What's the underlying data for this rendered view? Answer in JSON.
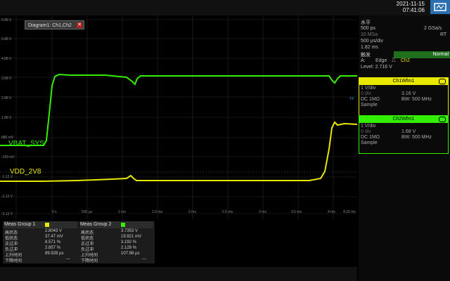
{
  "topbar": {
    "date": "2021-11-15",
    "time": "07:41:06"
  },
  "diagram": {
    "tab_title": "Diagram1: Ch1,Ch2",
    "close_glyph": "✕",
    "y_labels": [
      "6.88 V",
      "5.88 V",
      "4.88 V",
      "3.88 V",
      "2.88 V",
      "1.88 V",
      "880 mV",
      "-120 mV",
      "-1.12 V",
      "-2.12 V",
      "-3.12 V"
    ],
    "x_labels": [
      "0 s",
      "500 µs",
      "1 ms",
      "1.5 ms",
      "2 ms",
      "2.5 ms",
      "3 ms",
      "3.5 ms",
      "4 ms",
      "4.32 ms"
    ],
    "ch1_label": "VBAT_SYS",
    "ch2_label": "VDD_2V8",
    "ch1_color": "#33ee00",
    "ch2_color": "#e8e800",
    "ref_marker": "T4"
  },
  "horizontal": {
    "title": "水平",
    "timebase": "500 ps",
    "rate": "2 GSa/s",
    "rt": "RT",
    "mem": "10 MSa",
    "div": "500 µs/div",
    "acq": "1.82 ms"
  },
  "trigger": {
    "title": "触发",
    "mode": "Normal",
    "source_prefix": "A:",
    "type": "Edge",
    "source": "Ch2",
    "level": "Level: 2.716 V"
  },
  "ch1": {
    "title": "Ch1Wfm1",
    "scale": "1 V/div",
    "offset_label": "0 div",
    "offset_value": "3.16 V",
    "coupling": "DC 1MΩ",
    "bw": "BW: 500 MHz",
    "mode": "Sample"
  },
  "ch2": {
    "title": "Ch2Wfm1",
    "scale": "1 V/div",
    "offset_label": "0 div",
    "offset_value": "1.68 V",
    "coupling": "DC 1MΩ",
    "bw": "BW: 500 MHz",
    "mode": "Sample"
  },
  "meas1": {
    "title": "Meas Group 1",
    "rows": [
      {
        "label": "高状态",
        "value": "2.8043 V"
      },
      {
        "label": "低状态",
        "value": "37.47 mV"
      },
      {
        "label": "正过冲",
        "value": "8.571 %"
      },
      {
        "label": "负过冲",
        "value": "2.857 %"
      },
      {
        "label": "上升时间",
        "value": "89.928 µs"
      },
      {
        "label": "下降时间",
        "value": "---"
      }
    ]
  },
  "meas2": {
    "title": "Meas Group 2",
    "rows": [
      {
        "label": "高状态",
        "value": "3.7353 V"
      },
      {
        "label": "低状态",
        "value": "19.921 mV"
      },
      {
        "label": "正过冲",
        "value": "3.192 %"
      },
      {
        "label": "负过冲",
        "value": "2.128 %"
      },
      {
        "label": "上升时间",
        "value": "107.98 µs"
      },
      {
        "label": "下降时间",
        "value": "---"
      }
    ]
  }
}
